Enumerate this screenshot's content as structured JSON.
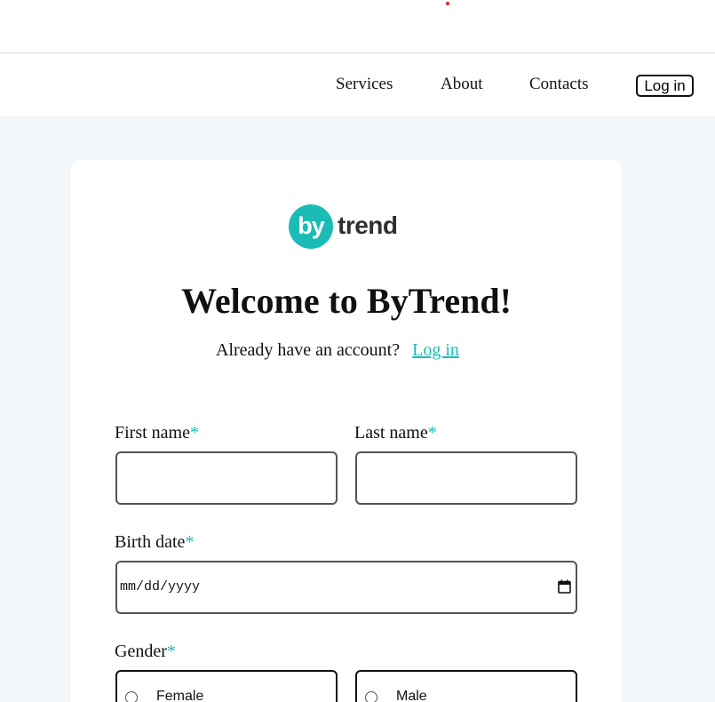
{
  "nav": {
    "items": [
      "Services",
      "About",
      "Contacts"
    ],
    "login_label": "Log in"
  },
  "logo": {
    "mark": "by",
    "word": "trend",
    "color": "#1bbcb6"
  },
  "heading": "Welcome to ByTrend!",
  "account": {
    "text": "Already have an account?",
    "link": "Log in"
  },
  "form": {
    "required_mark": "*",
    "first_name": {
      "label": "First name",
      "value": ""
    },
    "last_name": {
      "label": "Last name",
      "value": ""
    },
    "birth_date": {
      "label": "Birth date",
      "placeholder": "mm/dd/yyyy"
    },
    "gender": {
      "label": "Gender",
      "options": [
        "Female",
        "Male"
      ]
    }
  },
  "colors": {
    "accent": "#1bbcb6",
    "background": "#f4f7f9",
    "notification_dot": "#e0202a"
  }
}
